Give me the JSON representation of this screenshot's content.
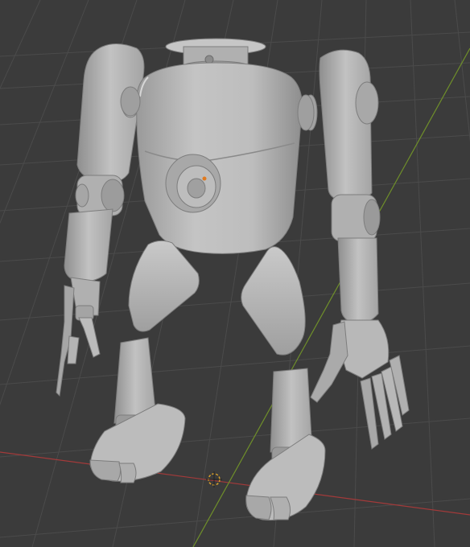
{
  "viewport": {
    "background_color": "#3b3b3b",
    "grid_line_color": "#4a4a4a",
    "x_axis_color": "#a33a3a",
    "y_axis_color": "#6f8f2a",
    "model_color": "#b4b4b4",
    "model_shadow_color": "#8c8c8c",
    "model_highlight_color": "#cfcfcf",
    "origin_marker_color": "#d8a02a",
    "object_origin_dot_color": "#e07a1f",
    "objects": [
      "robot-head-cap",
      "robot-torso",
      "robot-chest-dial",
      "robot-left-arm",
      "robot-right-arm",
      "robot-left-hand",
      "robot-right-hand",
      "robot-left-thigh",
      "robot-right-thigh",
      "robot-left-leg",
      "robot-right-leg",
      "robot-left-foot",
      "robot-right-foot"
    ],
    "icons": [
      "3d-cursor-icon",
      "object-origin-icon"
    ]
  }
}
